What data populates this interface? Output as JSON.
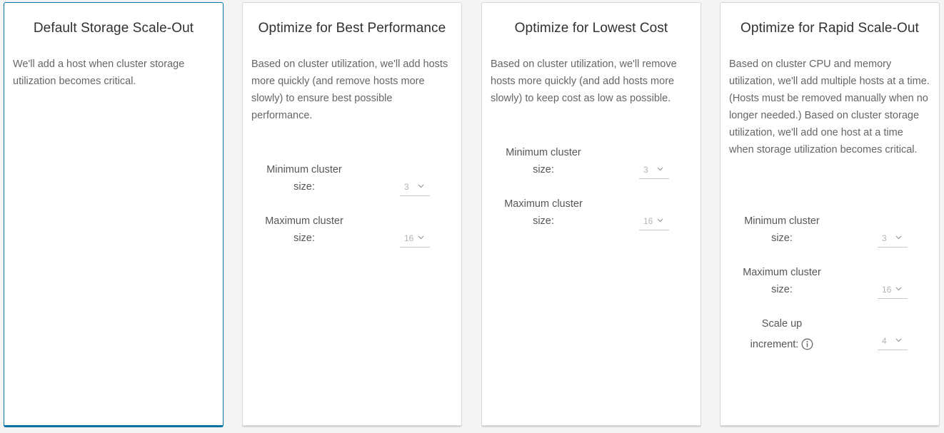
{
  "cards": [
    {
      "title": "Default Storage Scale-Out",
      "description": "We'll add a host when cluster storage utilization becomes critical."
    },
    {
      "title": "Optimize for Best Performance",
      "description": "Based on cluster utilization, we'll add hosts more quickly (and remove hosts more slowly) to ensure best possible performance.",
      "min_label": "Minimum cluster size:",
      "min_value": "3",
      "max_label": "Maximum cluster size:",
      "max_value": "16"
    },
    {
      "title": "Optimize for Lowest Cost",
      "description": "Based on cluster utilization, we'll remove hosts more quickly (and add hosts more slowly) to keep cost as low as possible.",
      "min_label": "Minimum cluster size:",
      "min_value": "3",
      "max_label": "Maximum cluster size:",
      "max_value": "16"
    },
    {
      "title": "Optimize for Rapid Scale-Out",
      "description": "Based on cluster CPU and memory utilization, we'll add multiple hosts at a time. (Hosts must be removed manually when no longer needed.) Based on cluster storage utilization, we'll add one host at a time when storage utilization becomes critical.",
      "min_label": "Minimum cluster size:",
      "min_value": "3",
      "max_label": "Maximum cluster size:",
      "max_value": "16",
      "increment_label_line1": "Scale up",
      "increment_label_line2": "increment:",
      "increment_value": "4"
    }
  ],
  "selected_card": 0,
  "colors": {
    "selected_border": "#0072a3",
    "card_border": "#d7d7d7",
    "background": "#f4f4f4"
  },
  "icons": {
    "chevron": "chevron-down-icon",
    "info": "info-icon"
  }
}
